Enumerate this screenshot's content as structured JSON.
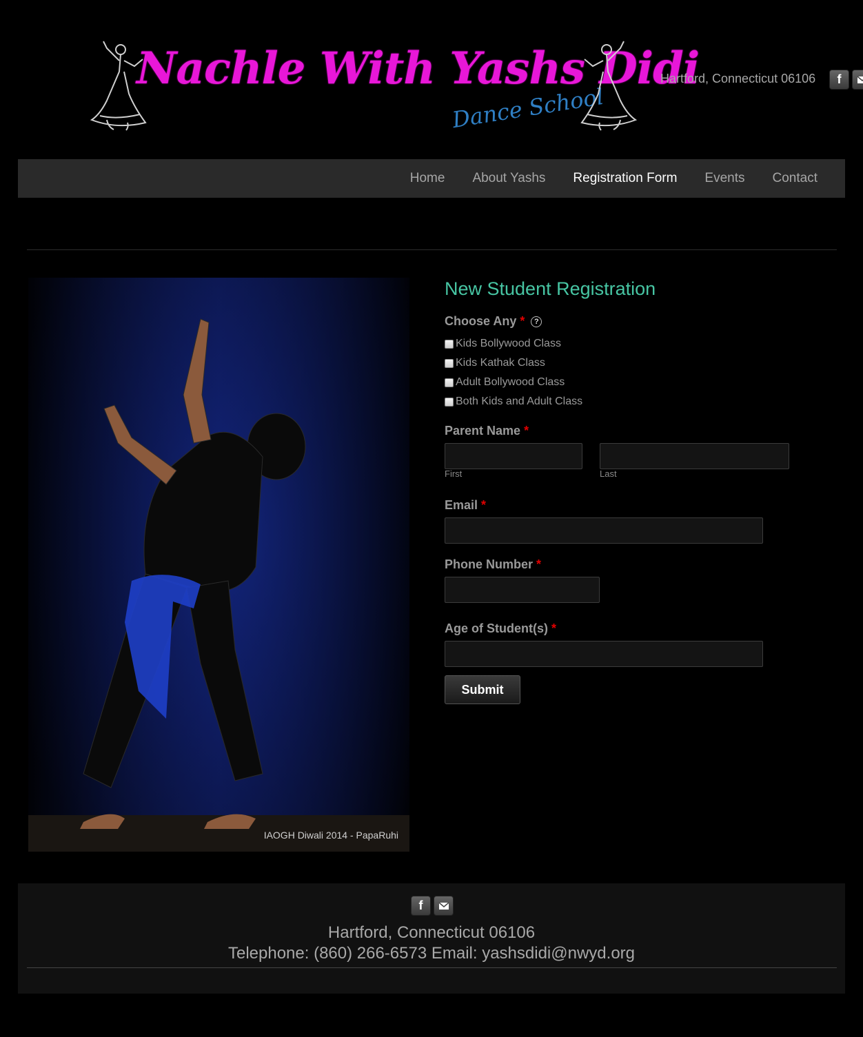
{
  "header": {
    "logo_title": "Nachle With Yashs Didi",
    "logo_subtitle": "Dance School",
    "address": "Hartford, Connecticut 06106",
    "social": {
      "facebook_icon": "facebook-icon",
      "email_icon": "email-icon"
    }
  },
  "nav": {
    "items": [
      {
        "label": "Home"
      },
      {
        "label": "About Yashs"
      },
      {
        "label": "Registration Form",
        "active": true
      },
      {
        "label": "Events"
      },
      {
        "label": "Contact"
      }
    ]
  },
  "photo": {
    "caption": "IAOGH Diwali 2014 - PapaRuhi"
  },
  "form": {
    "title": "New Student Registration",
    "choose": {
      "label": "Choose Any",
      "required_mark": "*",
      "help_icon": "?",
      "options": [
        "Kids Bollywood Class",
        "Kids Kathak Class",
        "Adult Bollywood Class",
        "Both Kids and Adult Class"
      ]
    },
    "parent_name": {
      "label": "Parent Name",
      "required_mark": "*",
      "first_label": "First",
      "last_label": "Last",
      "first_value": "",
      "last_value": ""
    },
    "email": {
      "label": "Email",
      "required_mark": "*",
      "value": ""
    },
    "phone": {
      "label": "Phone Number",
      "required_mark": "*",
      "value": ""
    },
    "age": {
      "label": "Age of Student(s)",
      "required_mark": "*",
      "value": ""
    },
    "submit_label": "Submit"
  },
  "footer": {
    "address": "Hartford, Connecticut 06106",
    "contact": "Telephone: (860) 266-6573 Email: yashsdidi@nwyd.org"
  },
  "colors": {
    "title_accent": "#47c5a3",
    "logo_pink": "#e817d8",
    "logo_blue": "#2f7fc4",
    "required_red": "#e00000",
    "nav_bg": "#2a2a2a"
  }
}
